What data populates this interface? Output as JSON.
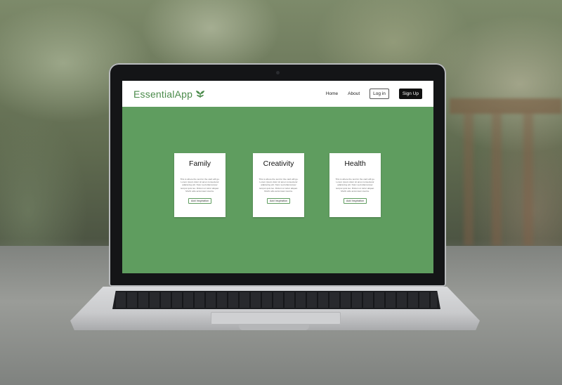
{
  "app": {
    "logo_text": "EssentialApp",
    "logo_icon": "leaf-sprout-icon",
    "brand_color": "#4b8b4b",
    "hero_color": "#5f9d5f"
  },
  "nav": {
    "home": "Home",
    "about": "About",
    "login": "Log in",
    "signup": "Sign Up"
  },
  "cards": [
    {
      "title": "Family",
      "body": "This is where the text for the card will go. Lorem ipsum dolor sit amet consectetur adipiscing elit. Nunc sed ullamcorper tempor quis leo. Dictum ut tortor aliquet. Morbi odio accumsan viverra.",
      "button": "Add Inspiration"
    },
    {
      "title": "Creativity",
      "body": "This is where the text for the card will go. Lorem ipsum dolor sit amet consectetur adipiscing elit. Nunc sed ullamcorper tempor quis leo. Dictum ut tortor aliquet. Morbi odio accumsan viverra.",
      "button": "Add Inspiration"
    },
    {
      "title": "Health",
      "body": "This is where the text for the card will go. Lorem ipsum dolor sit amet consectetur adipiscing elit. Nunc sed ullamcorper tempor quis leo. Dictum ut tortor aliquet. Morbi odio accumsan viverra.",
      "button": "Add Inspiration"
    }
  ]
}
